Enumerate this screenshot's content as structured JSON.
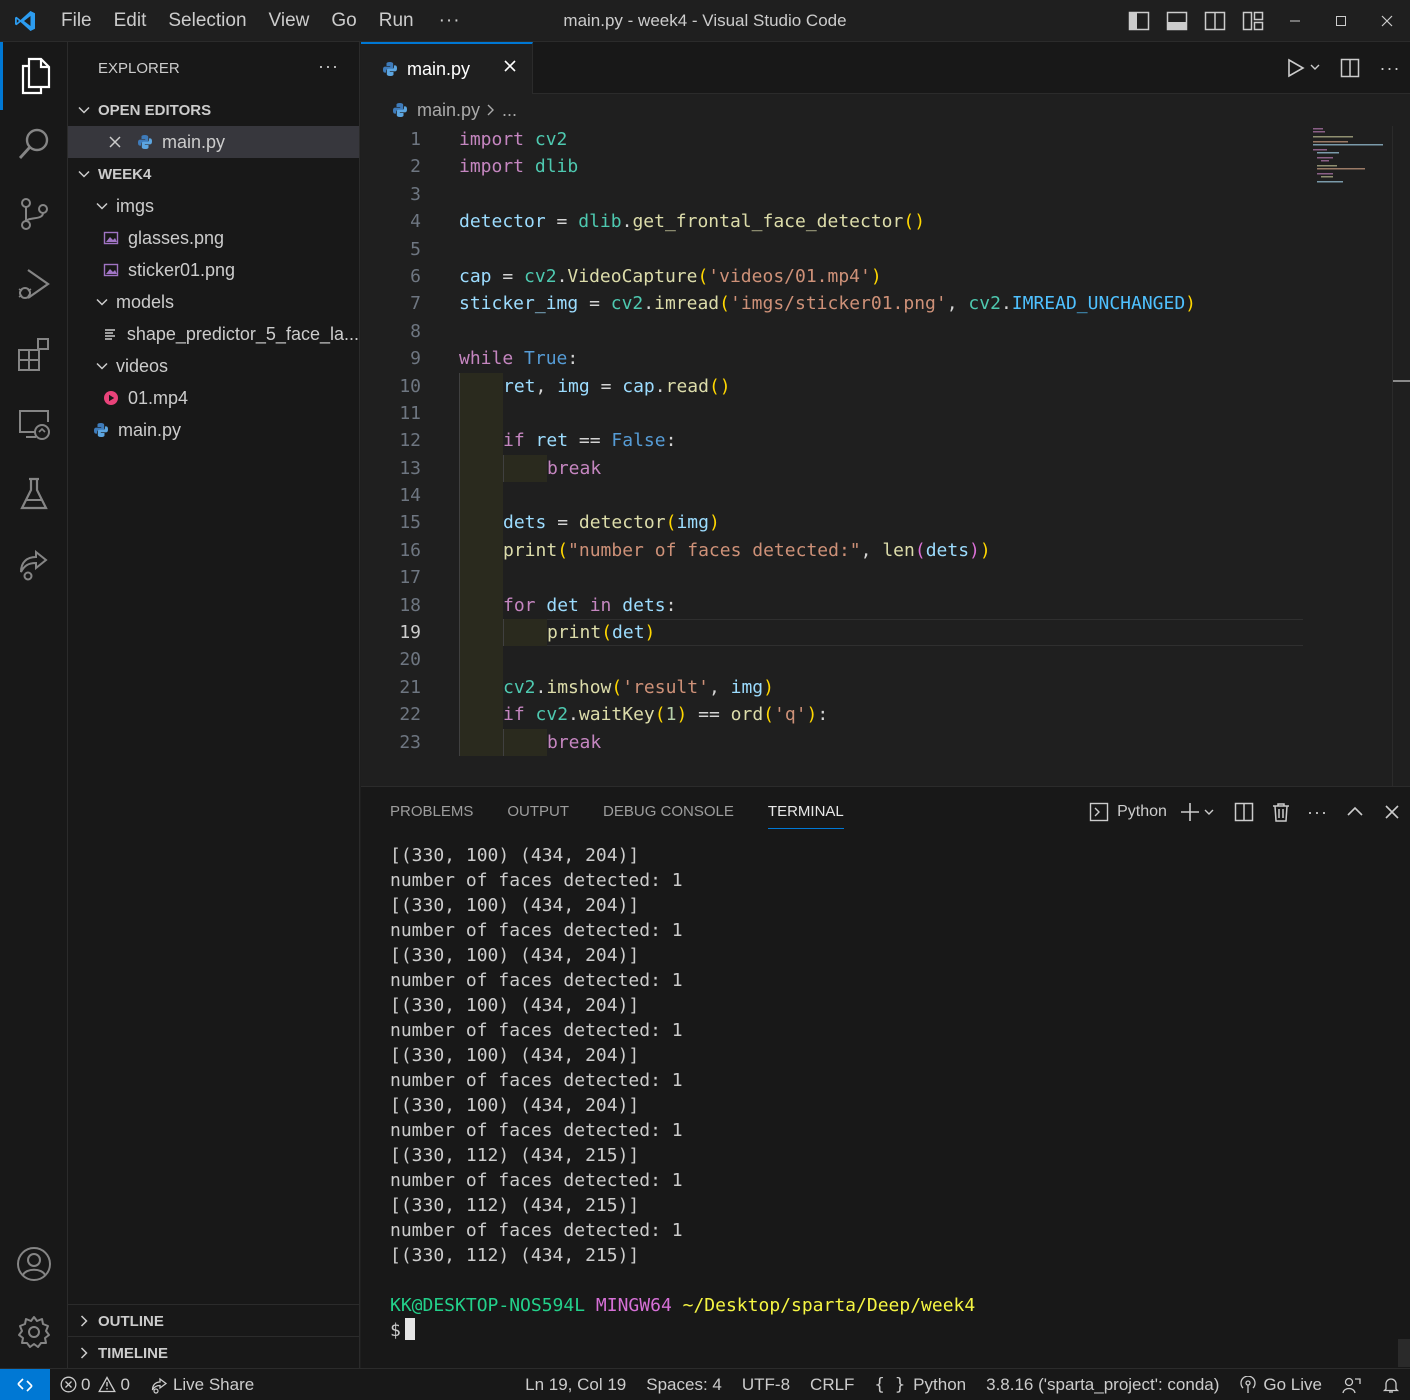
{
  "titlebar": {
    "menu": [
      "File",
      "Edit",
      "Selection",
      "View",
      "Go",
      "Run"
    ],
    "more": "···",
    "title": "main.py - week4 - Visual Studio Code"
  },
  "activitybar": {
    "items": [
      "explorer",
      "search",
      "source-control",
      "run-and-debug",
      "extensions",
      "remote-explorer",
      "testing",
      "live-share"
    ],
    "bottom": [
      "accounts",
      "manage"
    ]
  },
  "sidebar": {
    "header": "EXPLORER",
    "more": "···",
    "open_editors": "OPEN EDITORS",
    "open_editor_file": "main.py",
    "workspace": "WEEK4",
    "tree": [
      {
        "label": "imgs",
        "type": "folder",
        "depth": 1
      },
      {
        "label": "glasses.png",
        "type": "image",
        "depth": 2
      },
      {
        "label": "sticker01.png",
        "type": "image",
        "depth": 2
      },
      {
        "label": "models",
        "type": "folder",
        "depth": 1
      },
      {
        "label": "shape_predictor_5_face_la...",
        "type": "text",
        "depth": 2
      },
      {
        "label": "videos",
        "type": "folder",
        "depth": 1
      },
      {
        "label": "01.mp4",
        "type": "video",
        "depth": 2
      },
      {
        "label": "main.py",
        "type": "python",
        "depth": 1
      }
    ],
    "outline": "OUTLINE",
    "timeline": "TIMELINE"
  },
  "editor": {
    "tab_label": "main.py",
    "breadcrumb_file": "main.py",
    "breadcrumb_rest": "...",
    "current_line": 19,
    "line_numbers": [
      "1",
      "2",
      "3",
      "4",
      "5",
      "6",
      "7",
      "8",
      "9",
      "10",
      "11",
      "12",
      "13",
      "14",
      "15",
      "16",
      "17",
      "18",
      "19",
      "20",
      "21",
      "22",
      "23"
    ]
  },
  "panel": {
    "tabs": [
      "PROBLEMS",
      "OUTPUT",
      "DEBUG CONSOLE",
      "TERMINAL"
    ],
    "active_tab": "TERMINAL",
    "terminal_name": "Python",
    "output_lines": [
      "[(330, 100) (434, 204)]",
      "number of faces detected: 1",
      "[(330, 100) (434, 204)]",
      "number of faces detected: 1",
      "[(330, 100) (434, 204)]",
      "number of faces detected: 1",
      "[(330, 100) (434, 204)]",
      "number of faces detected: 1",
      "[(330, 100) (434, 204)]",
      "number of faces detected: 1",
      "[(330, 100) (434, 204)]",
      "number of faces detected: 1",
      "[(330, 112) (434, 215)]",
      "number of faces detected: 1",
      "[(330, 112) (434, 215)]",
      "number of faces detected: 1",
      "[(330, 112) (434, 215)]"
    ],
    "prompt_user": "KK@DESKTOP-NOS594L",
    "prompt_system": "MINGW64",
    "prompt_path": "~/Desktop/sparta/Deep/week4",
    "prompt_symbol": "$"
  },
  "statusbar": {
    "errors": "0",
    "warnings": "0",
    "live_share": "Live Share",
    "position": "Ln 19, Col 19",
    "spaces": "Spaces: 4",
    "encoding": "UTF-8",
    "eol": "CRLF",
    "language": "Python",
    "interpreter": "3.8.16 ('sparta_project': conda)",
    "go_live": "Go Live"
  },
  "colors": {
    "accent": "#0078d4",
    "keyword": "#c586c0",
    "function": "#dcdcaa",
    "string": "#ce9178",
    "variable": "#9cdcfe",
    "terminal_user": "#23d18b",
    "terminal_system": "#d670d6",
    "terminal_path": "#f5f543"
  }
}
